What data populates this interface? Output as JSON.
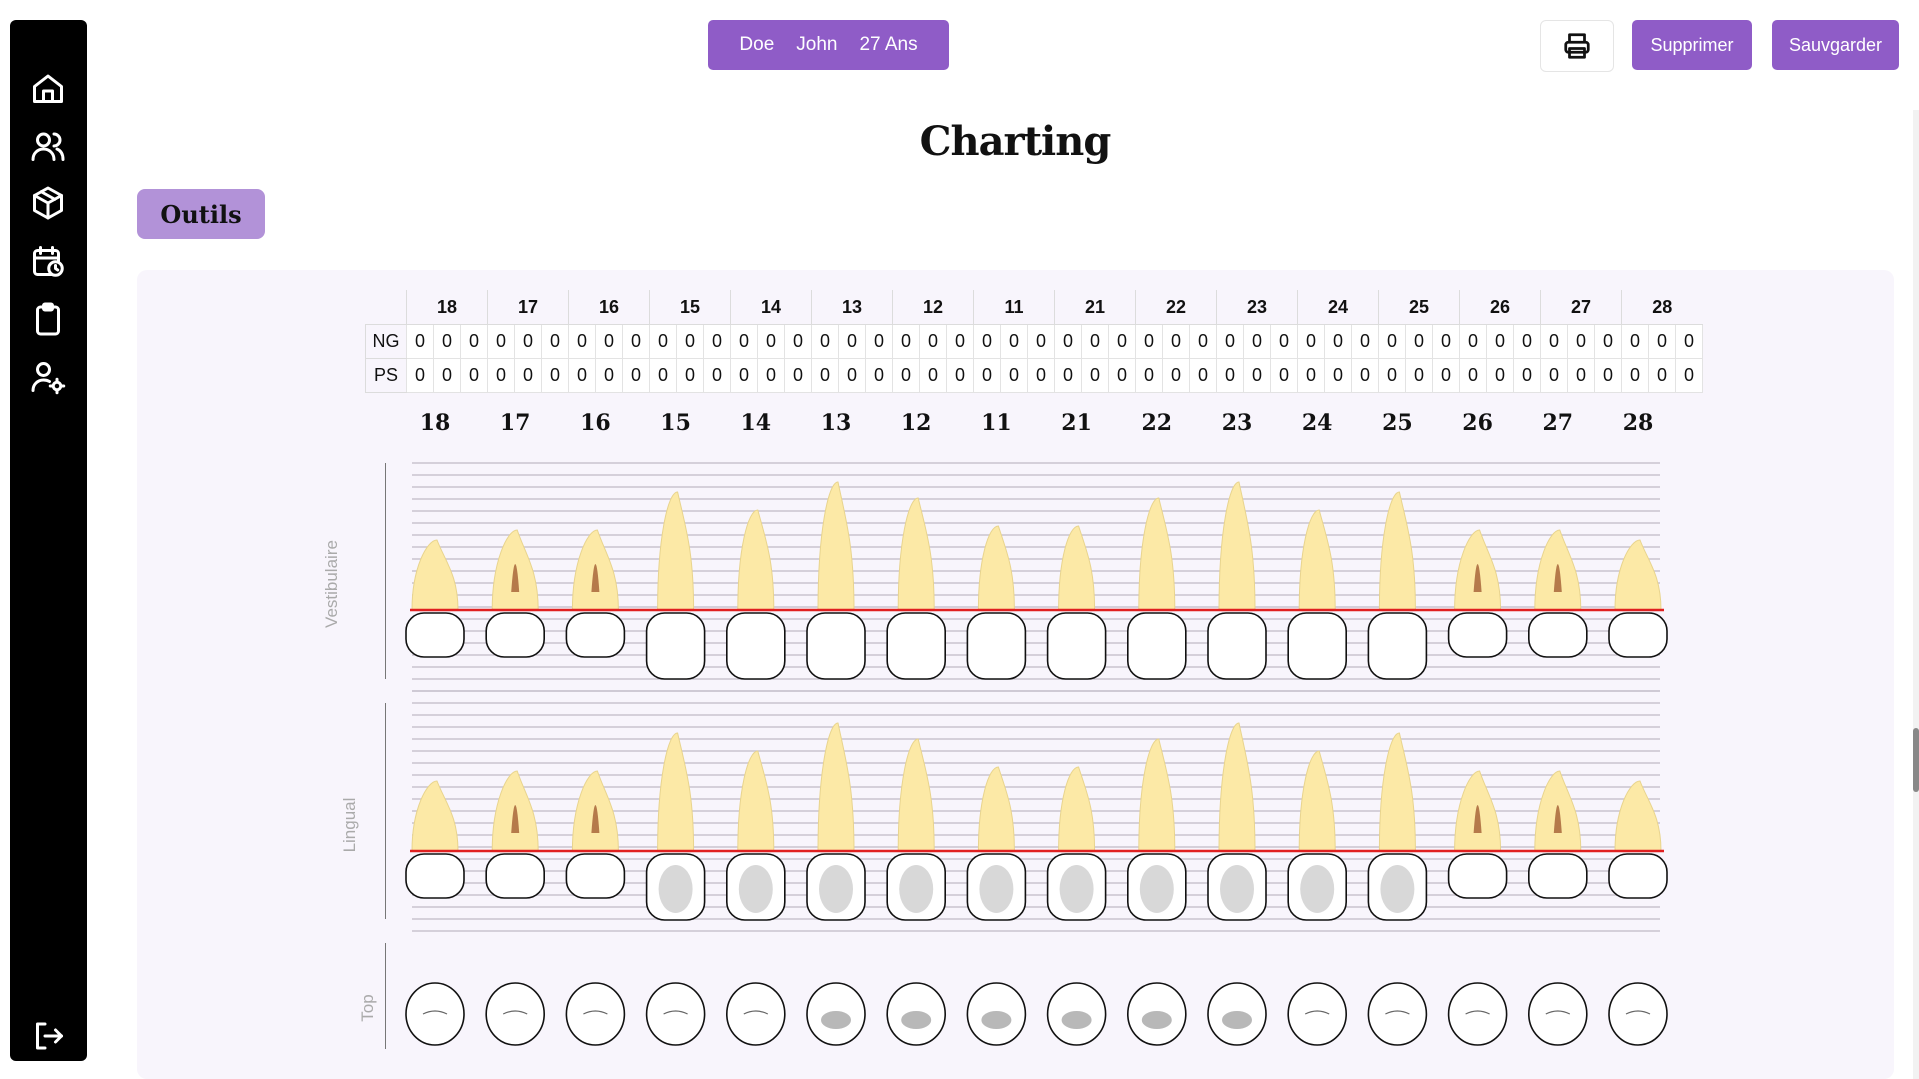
{
  "patient": {
    "last_name": "Doe",
    "first_name": "John",
    "age": "27 Ans"
  },
  "actions": {
    "delete_label": "Supprimer",
    "save_label": "Sauvgarder",
    "print_icon": "printer-icon"
  },
  "page": {
    "title": "Charting",
    "tools_label": "Outils"
  },
  "sidebar": {
    "items": [
      {
        "name": "home-icon"
      },
      {
        "name": "users-icon"
      },
      {
        "name": "box-icon"
      },
      {
        "name": "calendar-clock-icon"
      },
      {
        "name": "clipboard-icon"
      },
      {
        "name": "user-settings-icon"
      }
    ],
    "logout": {
      "name": "logout-icon"
    }
  },
  "teeth": [
    "18",
    "17",
    "16",
    "15",
    "14",
    "13",
    "12",
    "11",
    "21",
    "22",
    "23",
    "24",
    "25",
    "26",
    "27",
    "28"
  ],
  "measures": {
    "rows": [
      {
        "label": "NG",
        "values": [
          "0",
          "0",
          "0",
          "0",
          "0",
          "0",
          "0",
          "0",
          "0",
          "0",
          "0",
          "0",
          "0",
          "0",
          "0",
          "0",
          "0",
          "0",
          "0",
          "0",
          "0",
          "0",
          "0",
          "0",
          "0",
          "0",
          "0",
          "0",
          "0",
          "0",
          "0",
          "0",
          "0",
          "0",
          "0",
          "0",
          "0",
          "0",
          "0",
          "0",
          "0",
          "0",
          "0",
          "0",
          "0",
          "0",
          "0",
          "0"
        ]
      },
      {
        "label": "PS",
        "values": [
          "0",
          "0",
          "0",
          "0",
          "0",
          "0",
          "0",
          "0",
          "0",
          "0",
          "0",
          "0",
          "0",
          "0",
          "0",
          "0",
          "0",
          "0",
          "0",
          "0",
          "0",
          "0",
          "0",
          "0",
          "0",
          "0",
          "0",
          "0",
          "0",
          "0",
          "0",
          "0",
          "0",
          "0",
          "0",
          "0",
          "0",
          "0",
          "0",
          "0",
          "0",
          "0",
          "0",
          "0",
          "0",
          "0",
          "0",
          "0"
        ]
      }
    ]
  },
  "sections": {
    "vestibular": "Vestibulaire",
    "lingual": "Lingual",
    "top": "Top"
  },
  "colors": {
    "accent": "#8f5cc7",
    "tools": "#b292d8",
    "root": "#fce9a6",
    "decay": "#b57a4a",
    "gum_line": "#e02020"
  }
}
